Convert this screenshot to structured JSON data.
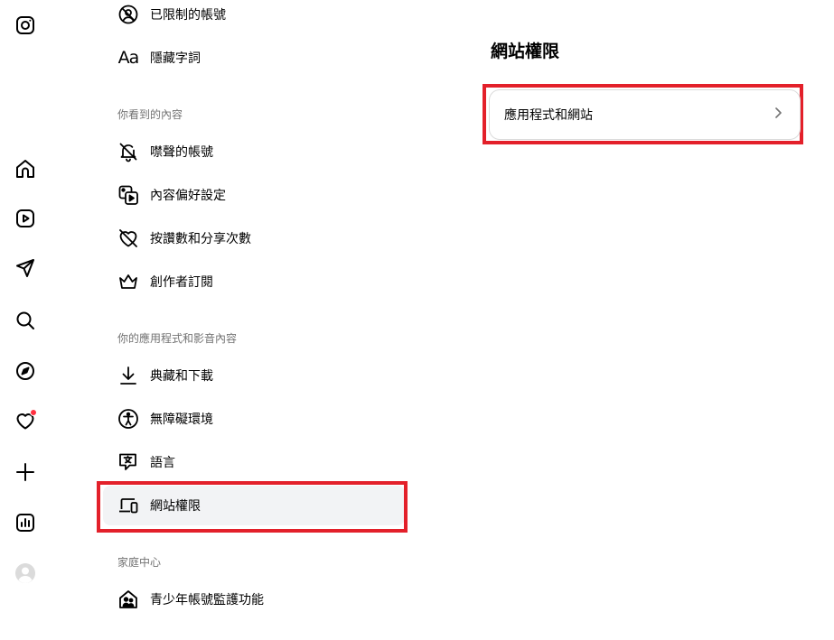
{
  "rail": {
    "icons": [
      "instagram-icon",
      "home-icon",
      "reels-icon",
      "messages-icon",
      "search-icon",
      "explore-icon",
      "notifications-icon",
      "create-icon",
      "insights-icon",
      "profile-icon"
    ],
    "notification_dot_color": "#ff3040"
  },
  "settings": {
    "item_restricted": "已限制的帳號",
    "item_hidden_words": "隱藏字詞",
    "aa_glyph": "Aa",
    "section_what_you_see": "你看到的內容",
    "item_muted": "噤聲的帳號",
    "item_content_prefs": "內容偏好設定",
    "item_like_share_counts": "按讚數和分享次數",
    "item_subscriptions": "創作者訂閱",
    "section_apps_media": "你的應用程式和影音內容",
    "item_archive_download": "典藏和下載",
    "item_accessibility": "無障礙環境",
    "item_language": "語言",
    "item_website_permissions": "網站權限",
    "section_family_center": "家庭中心",
    "item_supervision": "青少年帳號監護功能"
  },
  "detail": {
    "title": "網站權限",
    "row_apps_websites": "應用程式和網站"
  },
  "colors": {
    "highlight": "#e3202a",
    "active_bg": "#f2f3f5",
    "secondary_text": "#737373"
  }
}
